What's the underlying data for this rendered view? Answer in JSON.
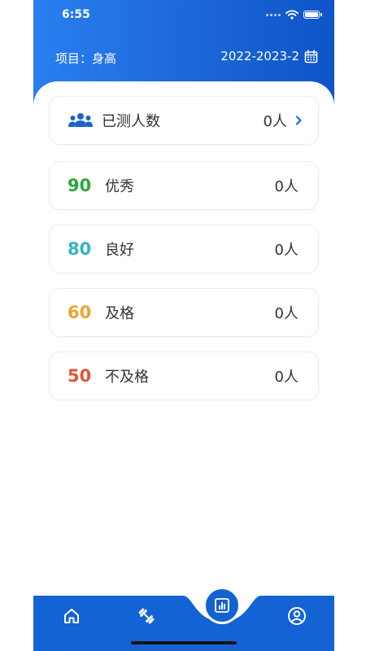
{
  "status": {
    "time": "6:55"
  },
  "header": {
    "project_label": "项目：身高",
    "term": "2022-2023-2"
  },
  "summary": {
    "label": "已测人数",
    "count": "0人"
  },
  "grades": [
    {
      "score": "90",
      "name": "优秀",
      "count": "0人",
      "color": "#2aa63b"
    },
    {
      "score": "80",
      "name": "良好",
      "count": "0人",
      "color": "#2fb6c5"
    },
    {
      "score": "60",
      "name": "及格",
      "count": "0人",
      "color": "#eda22f"
    },
    {
      "score": "50",
      "name": "不及格",
      "count": "0人",
      "color": "#e0553a"
    }
  ],
  "colors": {
    "primary": "#1463d4",
    "accent": "#1a63c9"
  },
  "tabs": [
    {
      "icon": "home-icon"
    },
    {
      "icon": "dumbbell-icon"
    },
    {
      "icon": "stats-icon"
    },
    {
      "icon": "profile-icon"
    }
  ]
}
